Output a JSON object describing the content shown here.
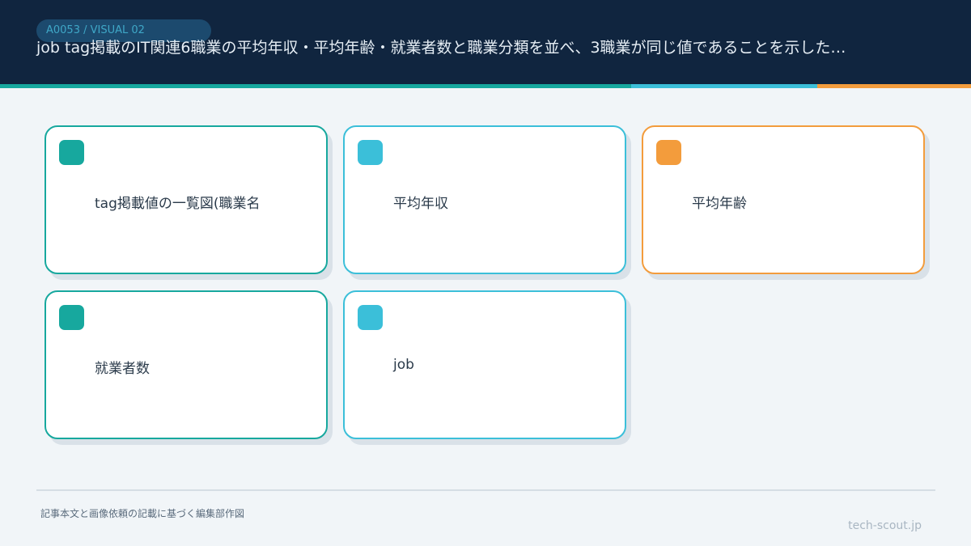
{
  "header": {
    "tag": "A0053 / VISUAL 02",
    "title": "job tag掲載のIT関連6職業の平均年収・平均年齢・就業者数と職業分類を並べ、3職業が同じ値であることを示した…"
  },
  "colors": {
    "header_bg": "#10253f",
    "teal": "#17a89e",
    "cyan": "#3bbfd9",
    "orange": "#f39c3c",
    "page_bg": "#f1f5f8"
  },
  "cards": [
    {
      "label": "tag掲載値の一覧図(職業名",
      "color": "teal"
    },
    {
      "label": "平均年収",
      "color": "cyan"
    },
    {
      "label": "平均年齢",
      "color": "orange"
    },
    {
      "label": "就業者数",
      "color": "teal"
    },
    {
      "label": "job",
      "color": "cyan"
    }
  ],
  "footer": {
    "note": "記事本文と画像依頼の記載に基づく編集部作図",
    "site": "tech-scout.jp"
  }
}
